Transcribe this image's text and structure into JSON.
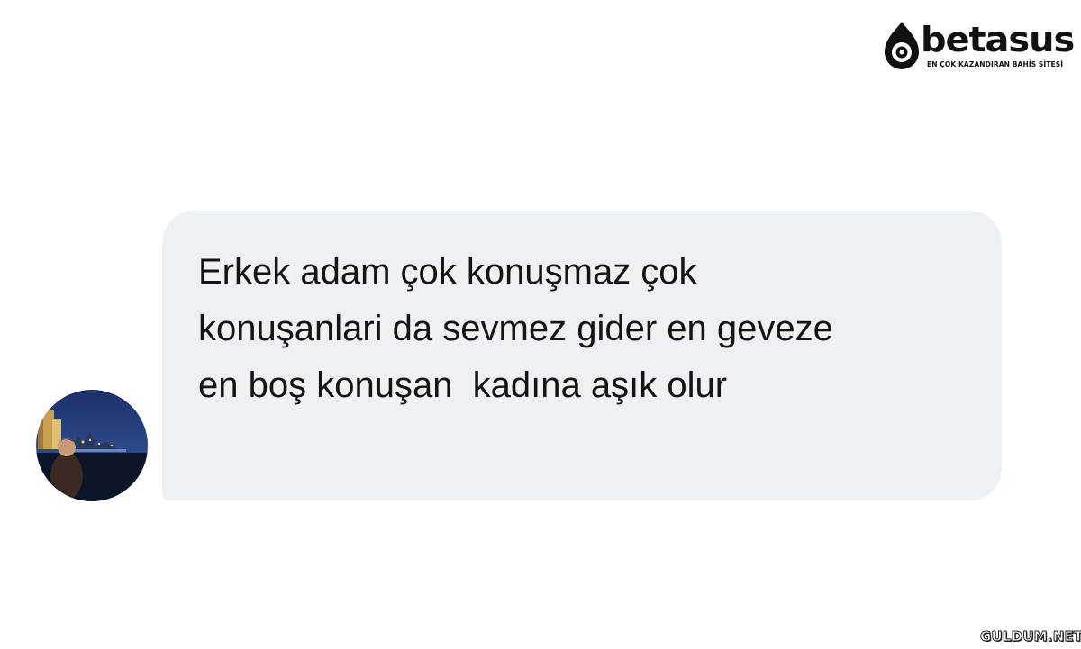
{
  "brand": {
    "name": "betasus",
    "tagline": "EN ÇOK KAZANDIRAN BAHİS SİTESİ",
    "icon": "betasus-logo-icon"
  },
  "message": {
    "text": "Erkek adam çok konuşmaz çok konuşanlari da sevmez gider en geveze en boş konuşan  kadına aşık olur",
    "avatar_icon": "user-avatar-photo",
    "bubble_color": "#eef1f4"
  },
  "watermark": {
    "text": "GULDUM.NET"
  }
}
